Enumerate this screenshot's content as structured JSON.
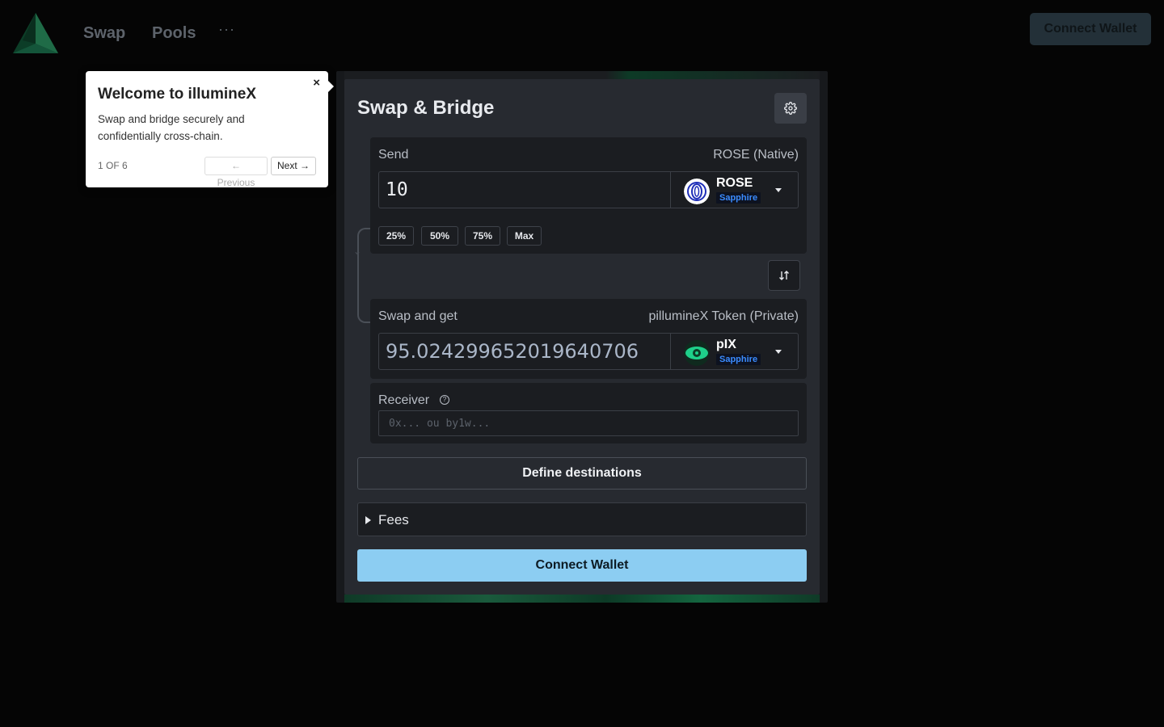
{
  "header": {
    "logo": "illuminex-logo-icon",
    "nav": [
      {
        "label": "Swap"
      },
      {
        "label": "Pools"
      }
    ],
    "more_label": "···",
    "connect_label": "Connect Wallet"
  },
  "tour": {
    "title": "Welcome to illumineX",
    "description": "Swap and bridge securely and confidentially cross-chain.",
    "progress": "1 OF 6",
    "prev_label": "← Previous",
    "next_label": "Next →",
    "close_label": "×"
  },
  "swap": {
    "title": "Swap & Bridge",
    "settings_icon": "gear-icon",
    "send": {
      "label": "Send",
      "token_full_name": "ROSE (Native)",
      "amount": "10",
      "token_symbol": "ROSE",
      "token_chain": "Sapphire",
      "percent_buttons": [
        "25%",
        "50%",
        "75%",
        "Max"
      ]
    },
    "switch_icon": "swap-arrows-icon",
    "receive": {
      "label": "Swap and get",
      "token_full_name": "pillumineX Token (Private)",
      "amount": "95.024299652019640706",
      "token_symbol": "pIX",
      "token_chain": "Sapphire"
    },
    "receiver": {
      "label": "Receiver",
      "help": "?",
      "placeholder": "0x... ou by1w..."
    },
    "define_destinations_label": "Define destinations",
    "fees_label": "Fees",
    "connect_label": "Connect Wallet"
  },
  "colors": {
    "background": "#050505",
    "card": "#272a30",
    "accent_button": "#8ccdf2",
    "chain_badge": "#3b8cff",
    "logo_green": "#1f6b47"
  }
}
